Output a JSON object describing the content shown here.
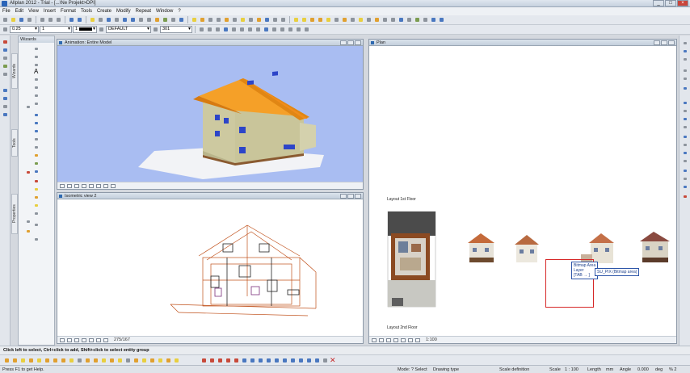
{
  "window": {
    "title": "Allplan 2012 - Trial - [...\\Ne Projekt>DPI]",
    "controls": [
      "_",
      "□",
      "×"
    ]
  },
  "menu": [
    "File",
    "Edit",
    "View",
    "Insert",
    "Format",
    "Tools",
    "Create",
    "Modify",
    "Repeat",
    "Window",
    "?"
  ],
  "format_bar": {
    "pen": "0.25",
    "line": "1",
    "color": "1",
    "layer": "DEFAULT",
    "hatch": "301"
  },
  "palette": {
    "title": "Wizards"
  },
  "side_tabs": [
    "Wizards",
    "Tools",
    "Properties"
  ],
  "views": {
    "animation": {
      "title": "Animation: Entire Model"
    },
    "iso": {
      "title": "Isometric view 2",
      "scale": "275/167"
    },
    "plan": {
      "title": "Plan",
      "scale": "1:100",
      "label_1st": "Layout 1st Floor",
      "label_2nd": "Layout 2nd Floor"
    }
  },
  "tooltip": {
    "line1": "Bitmap Area",
    "line2": "Layer",
    "line3": "[TAB → ]",
    "value": "SU_PIX (Bitmap area)"
  },
  "command_line": "Click left to select, Ctrl+click to add, Shift+click to select entity group",
  "status": {
    "help": "Press F1 to get Help.",
    "mode": "Mode: ? Select",
    "drawing_type": "Drawing type",
    "scale_def": "Scale definition",
    "scale_label": "Scale",
    "scale_val": "1 : 100",
    "length_label": "Length",
    "length_unit": "mm",
    "angle_label": "Angle",
    "angle_val": "0.000",
    "deg": "deg",
    "pct": "% 2"
  },
  "colors": {
    "roof": "#f08c1a",
    "wall": "#c9c59a",
    "sky": "#a9bdf2",
    "selection": "#d62828"
  }
}
